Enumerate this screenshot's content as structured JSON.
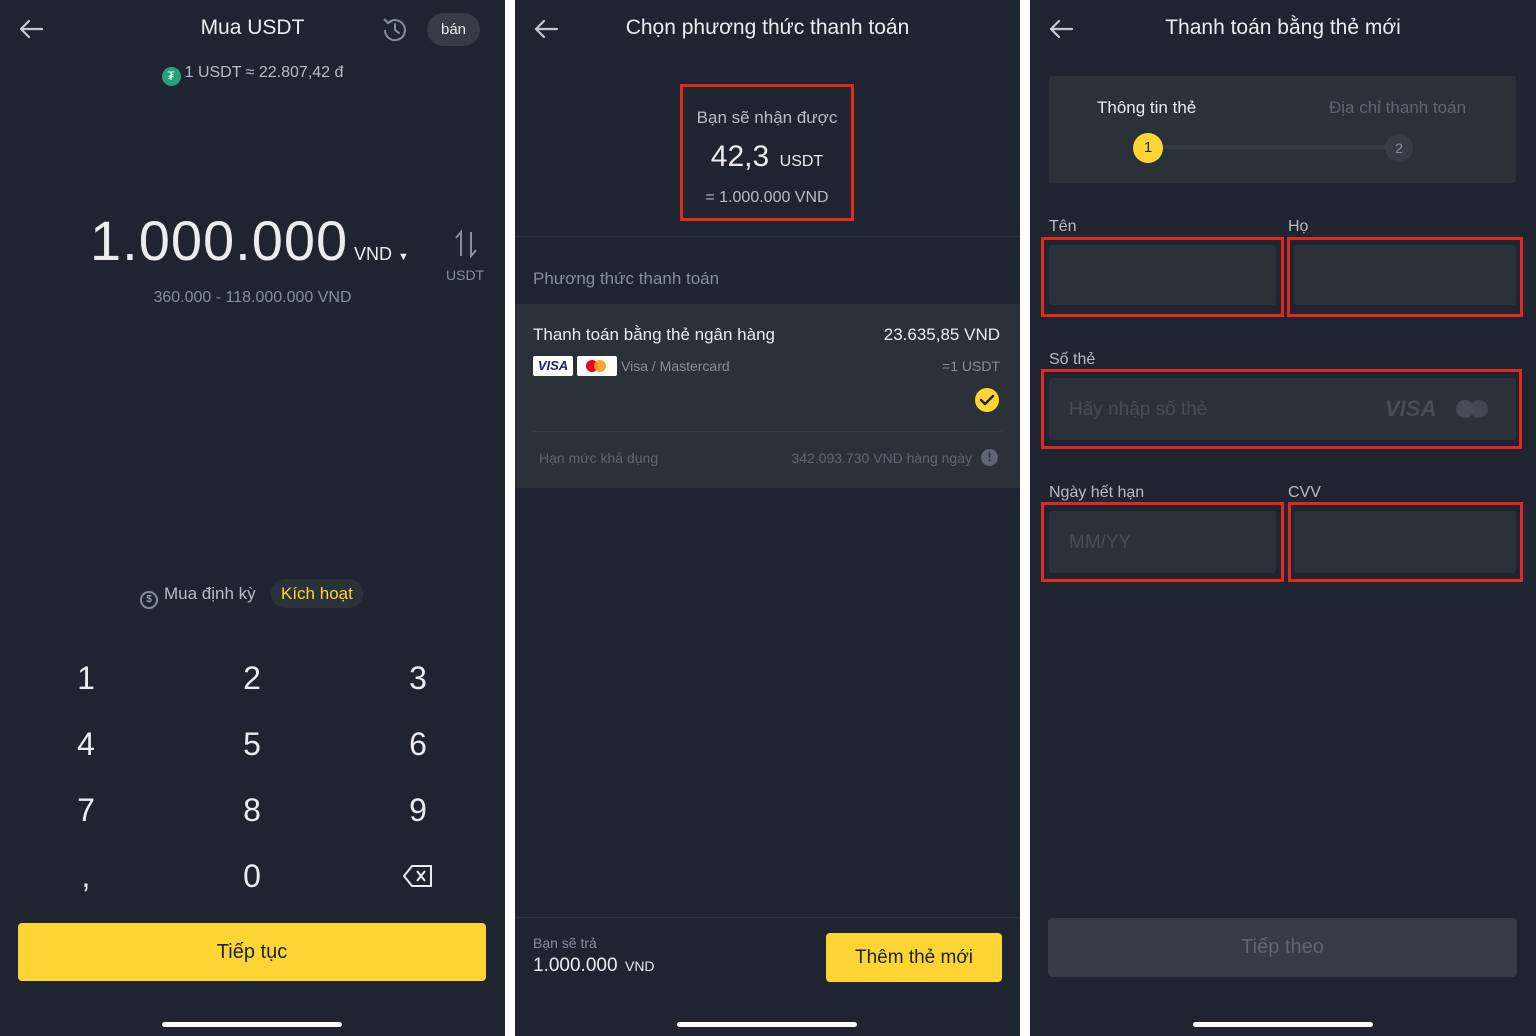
{
  "buy": {
    "title": "Mua USDT",
    "sell_label": "bán",
    "rate": "1 USDT ≈ 22.807,42 đ",
    "amount": "1.000.000",
    "currency": "VND",
    "range": "360.000 - 118.000.000 VND",
    "switch_label": "USDT",
    "recurring_label": "Mua định kỳ",
    "activate_label": "Kích hoạt",
    "keys": [
      "1",
      "2",
      "3",
      "4",
      "5",
      "6",
      "7",
      "8",
      "9",
      ",",
      "0"
    ],
    "continue_label": "Tiếp tục"
  },
  "method": {
    "title": "Chọn phương thức thanh toán",
    "receive_label": "Bạn sẽ nhận được",
    "receive_amount": "42,3",
    "receive_unit": "USDT",
    "receive_equiv": "= 1.000.000 VND",
    "section_label": "Phương thức thanh toán",
    "option_name": "Thanh toán bằng thẻ ngân hàng",
    "option_price": "23.635,85 VND",
    "option_cards": "Visa / Mastercard",
    "option_per": "=1 USDT",
    "limit_label": "Hạn mức khả dụng",
    "limit_value": "342.093.730 VND hàng ngày",
    "pay_label": "Bạn sẽ trả",
    "pay_amount": "1.000.000",
    "pay_unit": "VND",
    "add_card_label": "Thêm thẻ mới"
  },
  "card": {
    "title": "Thanh toán bằng thẻ mới",
    "step1_label": "Thông tin thẻ",
    "step2_label": "Địa chỉ thanh toán",
    "step1_num": "1",
    "step2_num": "2",
    "first_name_label": "Tên",
    "last_name_label": "Họ",
    "card_number_label": "Số thẻ",
    "card_number_placeholder": "Hãy nhập số thẻ",
    "visa_mark": "VISA",
    "expiry_label": "Ngày hết hạn",
    "expiry_placeholder": "MM/YY",
    "cvv_label": "CVV",
    "next_label": "Tiếp theo"
  },
  "colors": {
    "background": "#1f2530",
    "accent": "#fcd535",
    "highlight_border": "#e0281f",
    "input": "#2b3139"
  }
}
